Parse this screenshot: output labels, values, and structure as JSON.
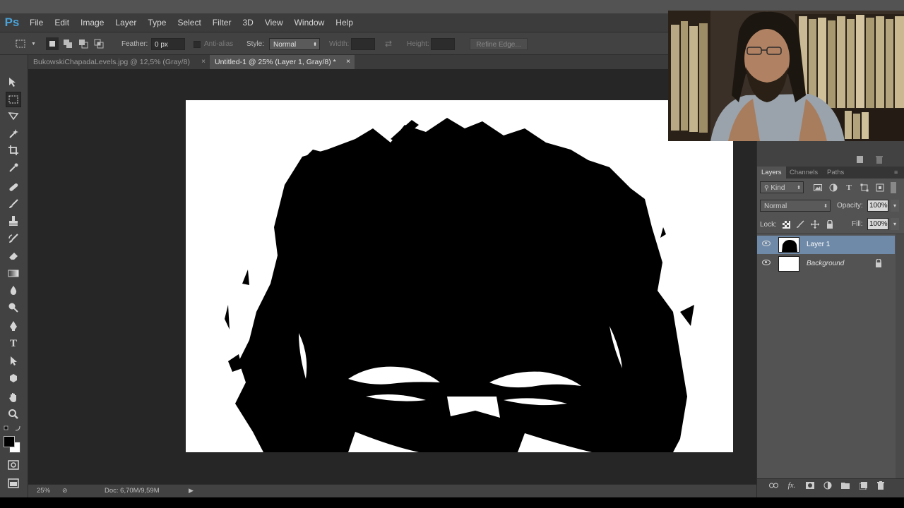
{
  "app": {
    "logo": "Ps"
  },
  "menu": [
    "File",
    "Edit",
    "Image",
    "Layer",
    "Type",
    "Select",
    "Filter",
    "3D",
    "View",
    "Window",
    "Help"
  ],
  "options": {
    "feather_label": "Feather:",
    "feather_value": "0 px",
    "antialias_label": "Anti-alias",
    "style_label": "Style:",
    "style_value": "Normal",
    "width_label": "Width:",
    "height_label": "Height:",
    "refine_label": "Refine Edge..."
  },
  "tabs": [
    {
      "label": "BukowskiChapadaLevels.jpg @ 12,5% (Gray/8)",
      "close": "×"
    },
    {
      "label": "Untitled-1 @ 25% (Layer 1, Gray/8) *",
      "close": "×"
    }
  ],
  "status": {
    "zoom": "25%",
    "doc": "Doc: 6,70M/9,59M"
  },
  "layers_panel": {
    "tabs": [
      "Layers",
      "Channels",
      "Paths"
    ],
    "filter_kind": "Kind",
    "blend_mode": "Normal",
    "opacity_label": "Opacity:",
    "opacity_value": "100%",
    "lock_label": "Lock:",
    "fill_label": "Fill:",
    "fill_value": "100%",
    "layers": [
      {
        "name": "Layer 1",
        "selected": true
      },
      {
        "name": "Background",
        "selected": false
      }
    ]
  },
  "colors": {
    "selection": "#6f8aa8",
    "accent": "#4aa2d8"
  },
  "icons": {
    "tools": [
      "move-icon",
      "marquee-icon",
      "lasso-icon",
      "magic-wand-icon",
      "crop-icon",
      "eyedropper-icon",
      "healing-icon",
      "brush-icon",
      "stamp-icon",
      "history-brush-icon",
      "eraser-icon",
      "gradient-icon",
      "blur-icon",
      "dodge-icon",
      "pen-icon",
      "type-icon",
      "path-select-icon",
      "shape-icon",
      "hand-icon",
      "zoom-icon"
    ]
  }
}
